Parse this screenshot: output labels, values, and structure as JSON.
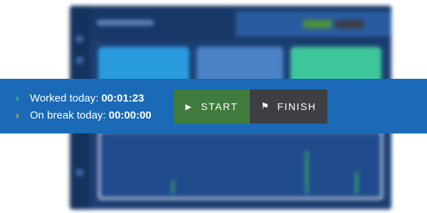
{
  "timer": {
    "worked_label": "Worked today:",
    "worked_value": "00:01:23",
    "break_label": "On break today:",
    "break_value": "00:00:00"
  },
  "actions": {
    "start_label": "START",
    "finish_label": "FINISH",
    "start_icon": "play-icon",
    "finish_icon": "flag-icon"
  },
  "colors": {
    "strip_background": "#1a6ab8",
    "start_button": "#3f7b3d",
    "finish_button": "#3d3f45",
    "worked_chevron": "#5fc44a",
    "break_chevron": "#f3a51b"
  }
}
